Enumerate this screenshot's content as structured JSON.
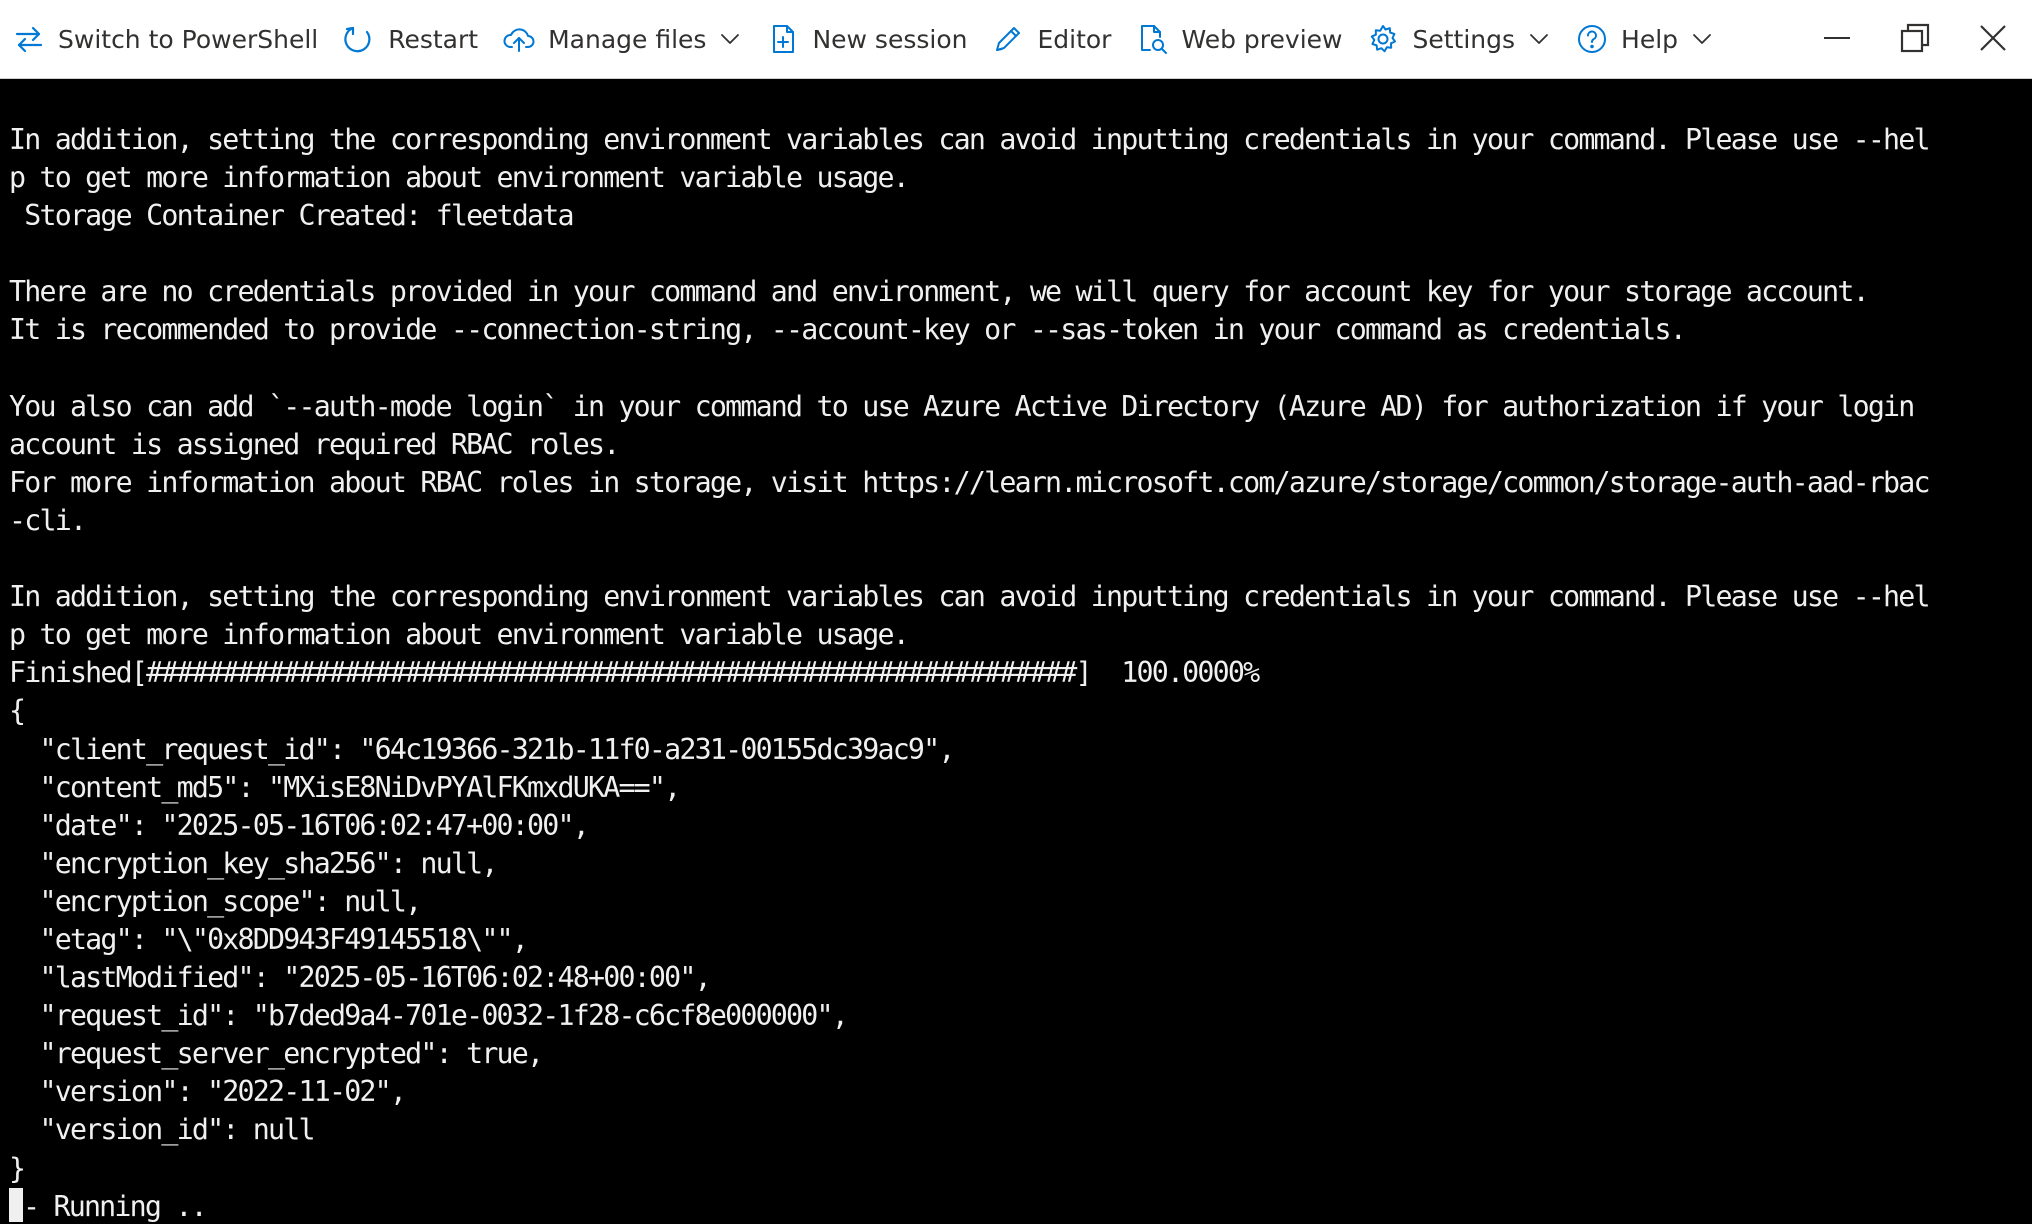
{
  "toolbar": {
    "items": [
      {
        "label": "Switch to PowerShell",
        "icon": "switch-arrows-icon",
        "has_dropdown": false
      },
      {
        "label": "Restart",
        "icon": "restart-icon",
        "has_dropdown": false
      },
      {
        "label": "Manage files",
        "icon": "cloud-upload-icon",
        "has_dropdown": true
      },
      {
        "label": "New session",
        "icon": "new-session-icon",
        "has_dropdown": false
      },
      {
        "label": "Editor",
        "icon": "pencil-icon",
        "has_dropdown": false
      },
      {
        "label": "Web preview",
        "icon": "web-preview-icon",
        "has_dropdown": false
      },
      {
        "label": "Settings",
        "icon": "gear-icon",
        "has_dropdown": true
      },
      {
        "label": "Help",
        "icon": "help-icon",
        "has_dropdown": true
      }
    ],
    "icon_color": "#0078d4",
    "text_color": "#323130"
  },
  "window_controls": [
    "minimize-icon",
    "restore-icon",
    "close-icon"
  ],
  "terminal": {
    "background": "#000000",
    "foreground": "#f0f0f0",
    "lines": [
      "In addition, setting the corresponding environment variables can avoid inputting credentials in your command. Please use --hel",
      "p to get more information about environment variable usage.",
      " Storage Container Created: fleetdata",
      "",
      "There are no credentials provided in your command and environment, we will query for account key for your storage account.",
      "It is recommended to provide --connection-string, --account-key or --sas-token in your command as credentials.",
      "",
      "You also can add `--auth-mode login` in your command to use Azure Active Directory (Azure AD) for authorization if your login",
      "account is assigned required RBAC roles.",
      "For more information about RBAC roles in storage, visit https://learn.microsoft.com/azure/storage/common/storage-auth-aad-rbac",
      "-cli.",
      "",
      "In addition, setting the corresponding environment variables can avoid inputting credentials in your command. Please use --hel",
      "p to get more information about environment variable usage.",
      "Finished[#############################################################]  100.0000%",
      "{",
      "  \"client_request_id\": \"64c19366-321b-11f0-a231-00155dc39ac9\",",
      "  \"content_md5\": \"MXisE8NiDvPYAlFKmxdUKA==\",",
      "  \"date\": \"2025-05-16T06:02:47+00:00\",",
      "  \"encryption_key_sha256\": null,",
      "  \"encryption_scope\": null,",
      "  \"etag\": \"\\\"0x8DD943F49145518\\\"\",",
      "  \"lastModified\": \"2025-05-16T06:02:48+00:00\",",
      "  \"request_id\": \"b7ded9a4-701e-0032-1f28-c6cf8e000000\",",
      "  \"request_server_encrypted\": true,",
      "  \"version\": \"2022-11-02\",",
      "  \"version_id\": null",
      "}"
    ],
    "prompt_line": "- Running .."
  }
}
